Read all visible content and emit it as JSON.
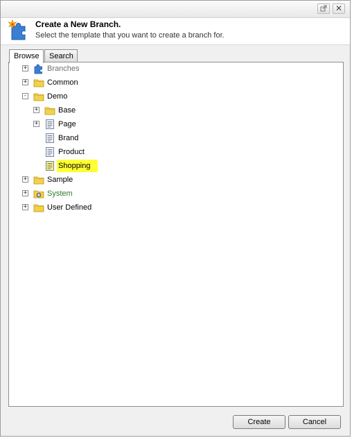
{
  "titlebar": {
    "popout_icon": "popout-icon",
    "close_icon": "close-icon"
  },
  "header": {
    "title": "Create a New Branch.",
    "subtitle": "Select the template that you want to create a branch for."
  },
  "tabs": [
    {
      "label": "Browse",
      "active": true
    },
    {
      "label": "Search",
      "active": false
    }
  ],
  "tree": {
    "nodes": [
      {
        "label": "Branches",
        "icon": "puzzle-icon",
        "expander": "+",
        "depth": 0,
        "style": "gray"
      },
      {
        "label": "Common",
        "icon": "folder-icon",
        "expander": "+",
        "depth": 0
      },
      {
        "label": "Demo",
        "icon": "folder-icon",
        "expander": "-",
        "depth": 0
      },
      {
        "label": "Base",
        "icon": "folder-icon",
        "expander": "+",
        "depth": 1
      },
      {
        "label": "Page",
        "icon": "template-icon",
        "expander": "+",
        "depth": 1
      },
      {
        "label": "Brand",
        "icon": "template-icon",
        "expander": "",
        "depth": 1
      },
      {
        "label": "Product",
        "icon": "template-icon",
        "expander": "",
        "depth": 1
      },
      {
        "label": "Shopping",
        "icon": "template-icon-yellow",
        "expander": "",
        "depth": 1,
        "selected": true
      },
      {
        "label": "Sample",
        "icon": "folder-icon",
        "expander": "+",
        "depth": 0
      },
      {
        "label": "System",
        "icon": "system-folder-icon",
        "expander": "+",
        "depth": 0,
        "style": "green"
      },
      {
        "label": "User Defined",
        "icon": "folder-icon",
        "expander": "+",
        "depth": 0
      }
    ]
  },
  "buttons": {
    "create_label": "Create",
    "cancel_label": "Cancel"
  },
  "colors": {
    "selection": "#ffff33",
    "folder": "#f2d24b",
    "system_label": "#2d7a28",
    "gray_label": "#6d6d6d"
  }
}
